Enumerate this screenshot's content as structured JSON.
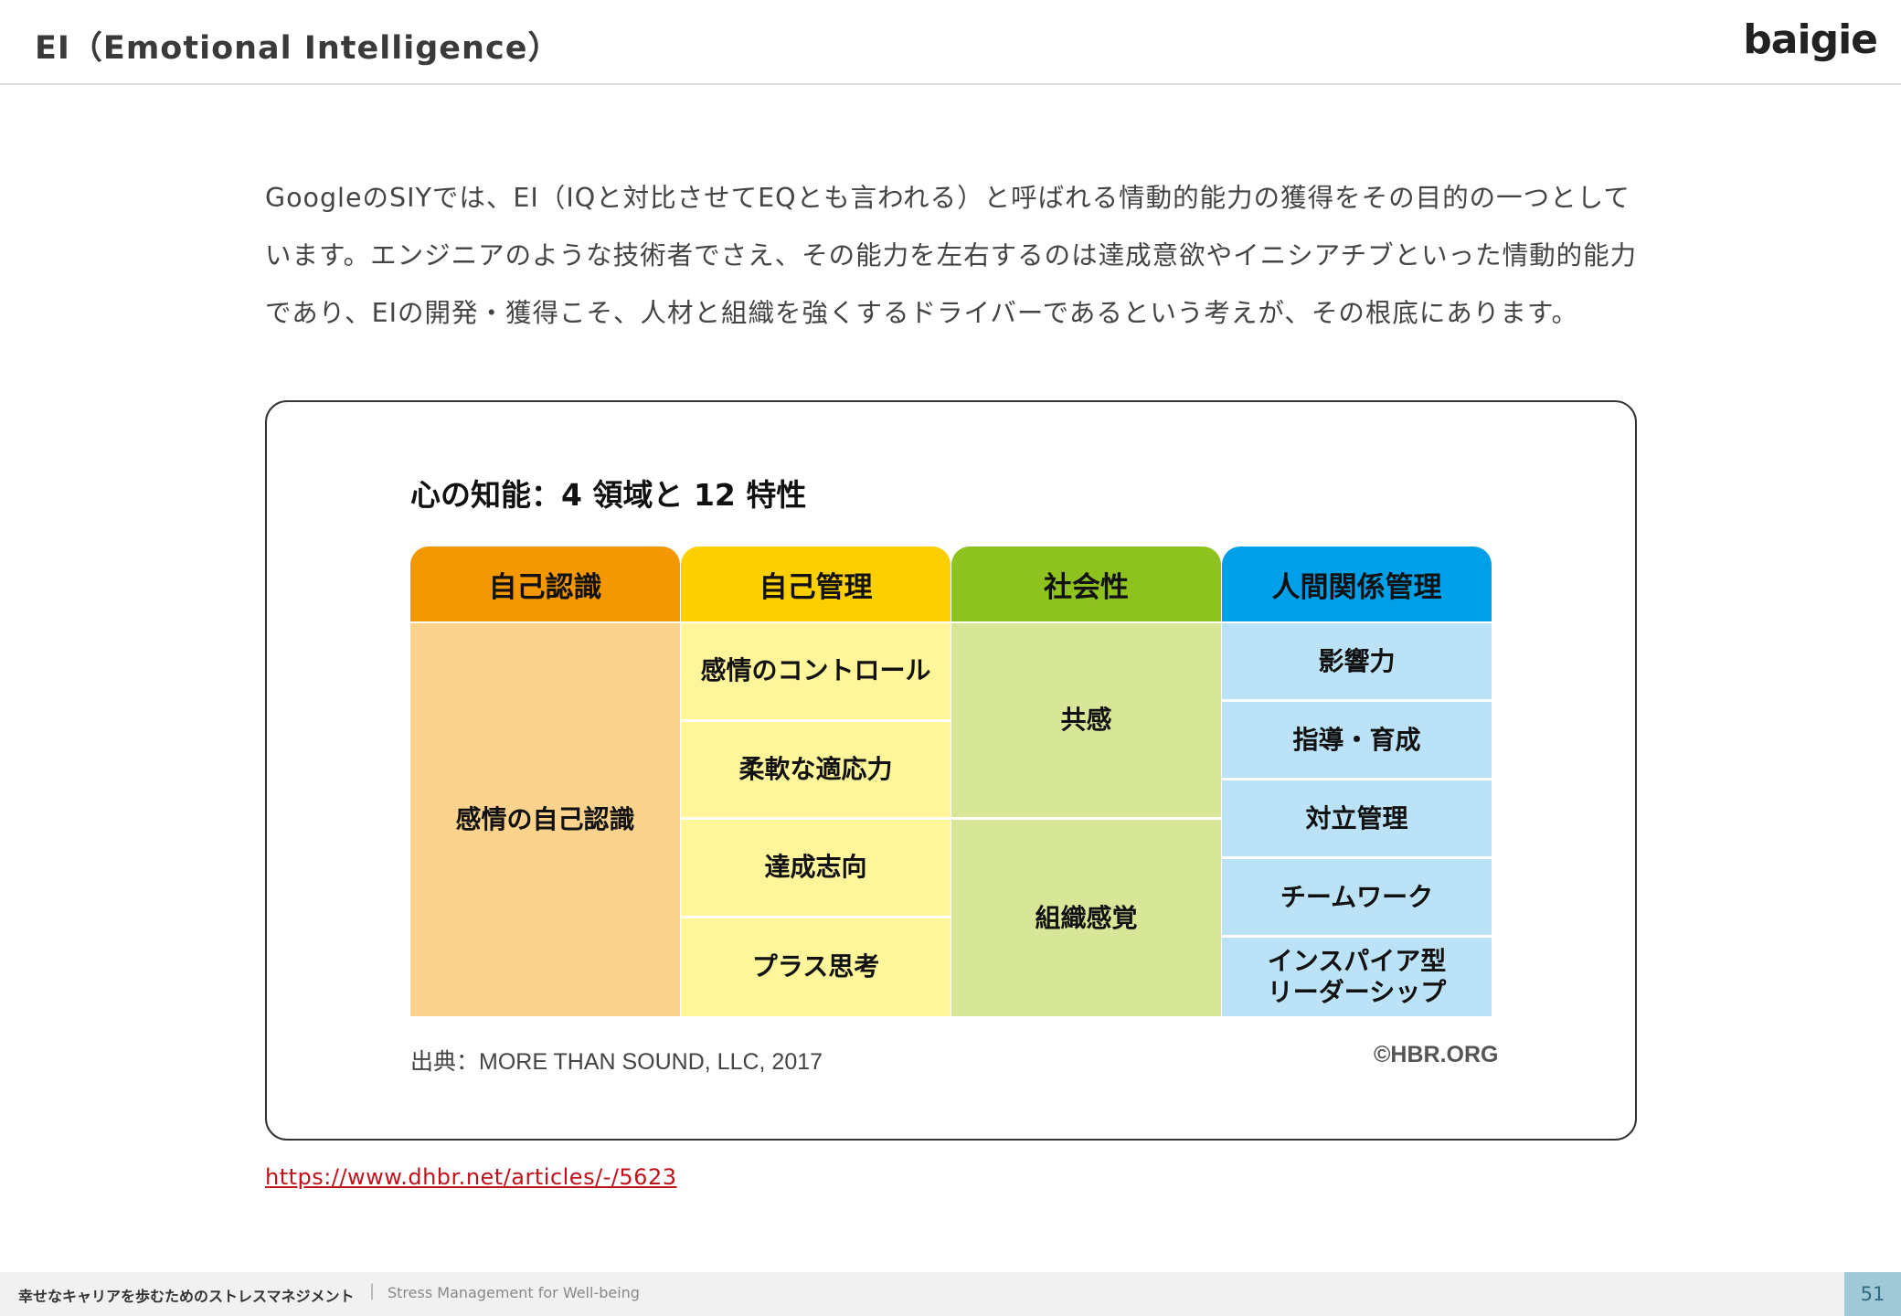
{
  "header": {
    "title": "EI（Emotional Intelligence）",
    "logo": "baigie"
  },
  "intro": {
    "lines": [
      "GoogleのSIYでは、EI（IQと対比させてEQとも言われる）と呼ばれる情動的能力の獲得をその目的の一つとして",
      "います。エンジニアのような技術者でさえ、その能力を左右するのは達成意欲やイニシアチブといった情動的能力",
      "であり、EIの開発・獲得こそ、人材と組織を強くするドライバーであるという考えが、その根底にあります。"
    ]
  },
  "figure": {
    "title": "心の知能：4 領域と 12 特性",
    "columns": [
      {
        "header": "自己認識",
        "header_color": "#F39800",
        "cell_color": "#FBD38D",
        "cells": [
          "感情の自己認識"
        ]
      },
      {
        "header": "自己管理",
        "header_color": "#FCD000",
        "cell_color": "#FFF59B",
        "cells": [
          "感情のコントロール",
          "柔軟な適応力",
          "達成志向",
          "プラス思考"
        ]
      },
      {
        "header": "社会性",
        "header_color": "#8DC21F",
        "cell_color": "#D8E698",
        "cells": [
          "共感",
          "組織感覚"
        ]
      },
      {
        "header": "人間関係管理",
        "header_color": "#00A0E9",
        "cell_color": "#BBE2F7",
        "cells": [
          "影響力",
          "指導・育成",
          "対立管理",
          "チームワーク",
          "インスパイア型\nリーダーシップ"
        ]
      }
    ],
    "source": "出典：MORE THAN SOUND, LLC, 2017",
    "copyright": "©HBR.ORG"
  },
  "link": {
    "text": "https://www.dhbr.net/articles/-/5623"
  },
  "footer": {
    "title_ja": "幸せなキャリアを歩むためのストレスマネジメント",
    "separator": "|",
    "title_en": "Stress Management for Well-being",
    "page_number": "51"
  }
}
